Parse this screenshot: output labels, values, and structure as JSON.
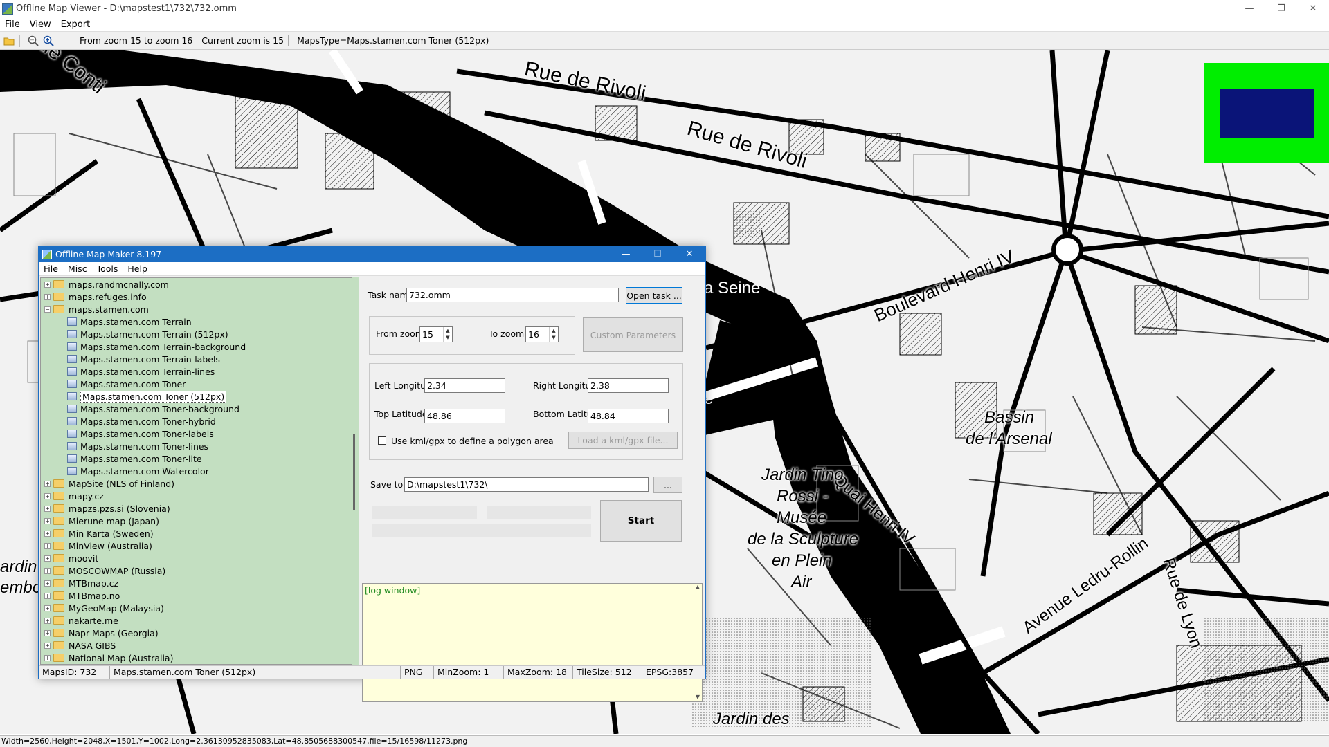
{
  "app": {
    "title": "Offline Map Viewer - D:\\mapstest1\\732\\732.omm",
    "window_controls": {
      "minimize": "—",
      "restore": "❐",
      "close": "✕"
    },
    "menu": [
      "File",
      "View",
      "Export"
    ]
  },
  "toolbar": {
    "icons": [
      "open-folder-icon",
      "zoom-out-icon",
      "zoom-in-icon"
    ],
    "zoom_range": "From zoom 15 to zoom 16",
    "current_zoom": "Current zoom is 15",
    "maps_type": "MapsType=Maps.stamen.com Toner (512px)"
  },
  "map": {
    "labels": {
      "conti": "de Conti",
      "rivoli1": "Rue de Rivoli",
      "rivoli2": "Rue de Rivoli",
      "boulevard": "Boulevard Henri IV",
      "seine": "a Seine",
      "e_frag": "e",
      "quai": "Quai Henri IV",
      "bassin": "Bassin",
      "arsenal": "de l'Arsenal",
      "jardin_tino": "Jardin Tino",
      "rossi": "Rossi -",
      "musee": "Musée",
      "sculpture": "de la Sculpture",
      "plein": "en Plein",
      "air": "Air",
      "ledru": "Avenue Ledru-Rollin",
      "lyon": "Rue de Lyon",
      "jardin_des": "Jardin des",
      "jardin_left": "ardin d",
      "embo": "embo"
    }
  },
  "minimap": {
    "frame_color": "#00ee00",
    "view_color": "#0a1478"
  },
  "statusbar": {
    "text": "Width=2560,Height=2048,X=1501,Y=1002,Long=2.36130952835083,Lat=48.8505688300547,file=15/16598/11273.png"
  },
  "dialog": {
    "title": "Offline Map Maker 8.197",
    "window_controls": {
      "minimize": "—",
      "maximize": "☐",
      "close": "✕"
    },
    "menu": [
      "File",
      "Misc",
      "Tools",
      "Help"
    ],
    "tree": [
      {
        "type": "folder",
        "label": "maps.randmcnally.com",
        "exp": "+"
      },
      {
        "type": "folder",
        "label": "maps.refuges.info",
        "exp": "+"
      },
      {
        "type": "folder",
        "label": "maps.stamen.com",
        "exp": "−"
      },
      {
        "type": "map",
        "label": "Maps.stamen.com Terrain"
      },
      {
        "type": "map",
        "label": "Maps.stamen.com Terrain (512px)"
      },
      {
        "type": "map",
        "label": "Maps.stamen.com Terrain-background"
      },
      {
        "type": "map",
        "label": "Maps.stamen.com Terrain-labels"
      },
      {
        "type": "map",
        "label": "Maps.stamen.com Terrain-lines"
      },
      {
        "type": "map",
        "label": "Maps.stamen.com Toner"
      },
      {
        "type": "map",
        "label": "Maps.stamen.com Toner (512px)",
        "selected": true
      },
      {
        "type": "map",
        "label": "Maps.stamen.com Toner-background"
      },
      {
        "type": "map",
        "label": "Maps.stamen.com Toner-hybrid"
      },
      {
        "type": "map",
        "label": "Maps.stamen.com Toner-labels"
      },
      {
        "type": "map",
        "label": "Maps.stamen.com Toner-lines"
      },
      {
        "type": "map",
        "label": "Maps.stamen.com Toner-lite"
      },
      {
        "type": "map",
        "label": "Maps.stamen.com Watercolor"
      },
      {
        "type": "folder",
        "label": "MapSite (NLS of Finland)",
        "exp": "+"
      },
      {
        "type": "folder",
        "label": "mapy.cz",
        "exp": "+"
      },
      {
        "type": "folder",
        "label": "mapzs.pzs.si (Slovenia)",
        "exp": "+"
      },
      {
        "type": "folder",
        "label": "Mierune map (Japan)",
        "exp": "+"
      },
      {
        "type": "folder",
        "label": "Min Karta (Sweden)",
        "exp": "+"
      },
      {
        "type": "folder",
        "label": "MinView (Australia)",
        "exp": "+"
      },
      {
        "type": "folder",
        "label": "moovit",
        "exp": "+"
      },
      {
        "type": "folder",
        "label": "MOSCOWMAP (Russia)",
        "exp": "+"
      },
      {
        "type": "folder",
        "label": "MTBmap.cz",
        "exp": "+"
      },
      {
        "type": "folder",
        "label": "MTBmap.no",
        "exp": "+"
      },
      {
        "type": "folder",
        "label": "MyGeoMap (Malaysia)",
        "exp": "+"
      },
      {
        "type": "folder",
        "label": "nakarte.me",
        "exp": "+"
      },
      {
        "type": "folder",
        "label": "Napr Maps (Georgia)",
        "exp": "+"
      },
      {
        "type": "folder",
        "label": "NASA GIBS",
        "exp": "+"
      },
      {
        "type": "folder",
        "label": "National Map (Australia)",
        "exp": "+"
      }
    ],
    "form": {
      "task_name_label": "Task name",
      "task_name_value": "732.omm",
      "open_task": "Open task ...",
      "from_zoom_label": "From zoom",
      "from_zoom_value": "15",
      "to_zoom_label": "To zoom",
      "to_zoom_value": "16",
      "custom_params": "Custom Parameters",
      "left_lon_label": "Left Longitude",
      "left_lon_value": "2.34",
      "right_lon_label": "Right Longitude",
      "right_lon_value": "2.38",
      "top_lat_label": "Top Latitude",
      "top_lat_value": "48.86",
      "bottom_lat_label": "Bottom Latitude",
      "bottom_lat_value": "48.84",
      "kml_label": "Use kml/gpx to define a polygon area",
      "load_kml": "Load a kml/gpx file...",
      "save_to_label": "Save to:",
      "save_to_value": "D:\\mapstest1\\732\\",
      "browse": "...",
      "start": "Start",
      "log": "[log window]"
    },
    "status": {
      "maps_id": "MapsID: 732",
      "maps_name": "Maps.stamen.com Toner (512px)",
      "format": "PNG",
      "min_zoom": "MinZoom: 1",
      "max_zoom": "MaxZoom: 18",
      "tile_size": "TileSize: 512",
      "epsg": "EPSG:3857"
    }
  }
}
